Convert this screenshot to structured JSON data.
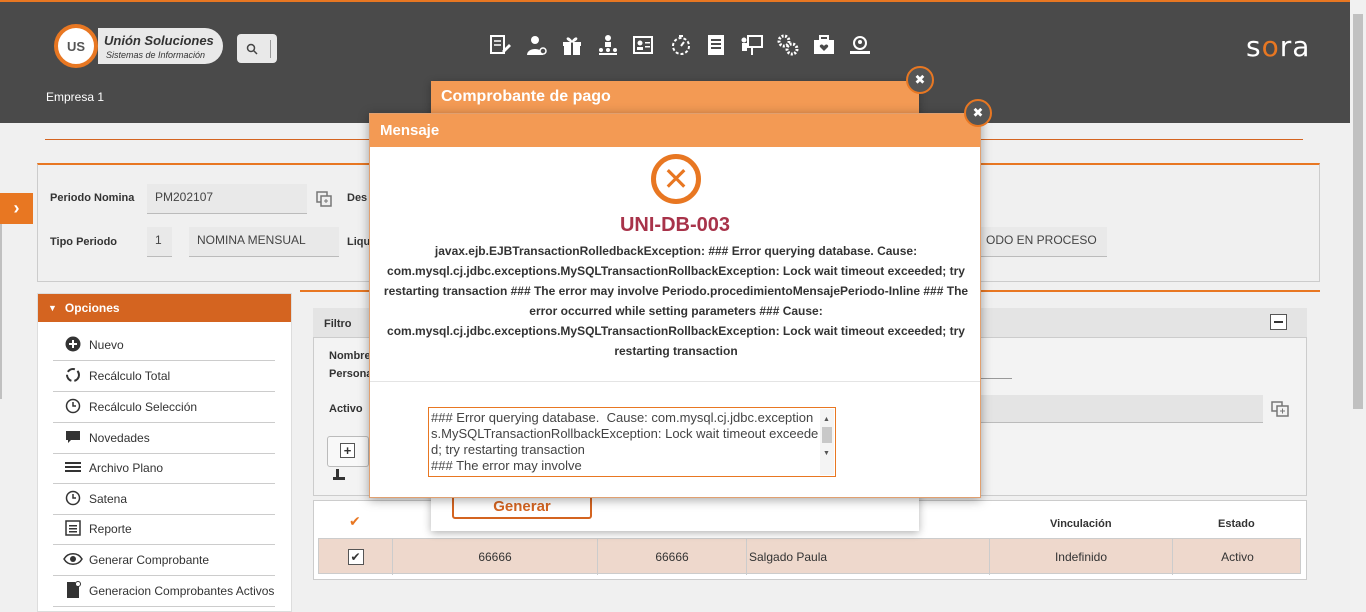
{
  "header": {
    "logo_mark": "US",
    "logo_title": "Unión Soluciones",
    "logo_subtitle": "Sistemas de Información",
    "brand_prefix": "s",
    "brand_accent": "o",
    "brand_suffix": "ra",
    "company": "Empresa 1",
    "nav_icons": [
      "document-edit-icon",
      "user-settings-icon",
      "gift-icon",
      "org-chart-icon",
      "id-card-icon",
      "stopwatch-icon",
      "report-icon",
      "presentation-icon",
      "gears-icon",
      "briefcase-heart-icon",
      "people-search-icon"
    ]
  },
  "filters": {
    "periodo_label": "Periodo Nomina",
    "periodo_value": "PM202107",
    "desc_label": "Des",
    "tipo_label": "Tipo Periodo",
    "tipo_code": "1",
    "tipo_value": "NOMINA MENSUAL",
    "liq_label": "Liqu",
    "estado_value": "ODO EN PROCESO"
  },
  "options": {
    "title": "Opciones",
    "items": [
      {
        "label": "Nuevo",
        "icon": "plus-circle-icon"
      },
      {
        "label": "Recálculo Total",
        "icon": "refresh-icon"
      },
      {
        "label": "Recálculo Selección",
        "icon": "clock-icon"
      },
      {
        "label": "Novedades",
        "icon": "comment-icon"
      },
      {
        "label": "Archivo Plano",
        "icon": "lines-icon"
      },
      {
        "label": "Satena",
        "icon": "clock-icon"
      },
      {
        "label": "Reporte",
        "icon": "list-icon"
      },
      {
        "label": "Generar Comprobante",
        "icon": "eye-icon"
      },
      {
        "label": "Generacion Comprobantes Activos",
        "icon": "file-icon"
      }
    ]
  },
  "filtro": {
    "title": "Filtro",
    "nombre_label": "Nombre",
    "persona_label": "Persona",
    "activo_label": "Activo"
  },
  "table": {
    "headers": {
      "vinculacion": "Vinculación",
      "estado": "Estado"
    },
    "row": {
      "col1": "66666",
      "col2": "66666",
      "nombre": "Salgado Paula",
      "vinculacion": "Indefinido",
      "estado": "Activo"
    }
  },
  "comprobante": {
    "title": "Comprobante de pago",
    "generate_label": "Generar"
  },
  "message": {
    "title": "Mensaje",
    "code": "UNI-DB-003",
    "text": "javax.ejb.EJBTransactionRolledbackException: ### Error querying database. Cause: com.mysql.cj.jdbc.exceptions.MySQLTransactionRollbackException: Lock wait timeout exceeded; try restarting transaction ### The error may involve Periodo.procedimientoMensajePeriodo-Inline ### The error occurred while setting parameters ### Cause: com.mysql.cj.jdbc.exceptions.MySQLTransactionRollbackException: Lock wait timeout exceeded; try restarting transaction",
    "detail": "### Error querying database.  Cause: com.mysql.cj.jdbc.exceptions.MySQLTransactionRollbackException: Lock wait timeout exceeded; try restarting transaction\n### The error may involve"
  },
  "colors": {
    "accent": "#e87722",
    "header_bg": "#4a4a4a",
    "error_code": "#a8334a"
  }
}
